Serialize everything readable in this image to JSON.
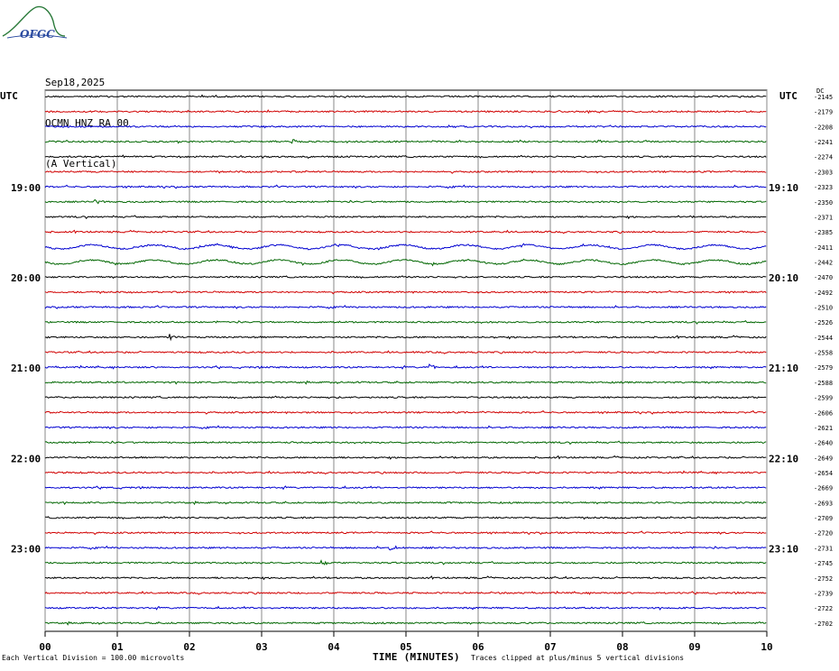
{
  "logo": {
    "text": "OFGC",
    "color": "#2a7a3a"
  },
  "header": {
    "date": "Sep18,2025",
    "station": "OCMN HNZ RA 00",
    "component": "(A Vertical)"
  },
  "utc_label_left": "UTC",
  "utc_label_right": "UTC",
  "dc_label": "DC",
  "footnote_left": "Each Vertical Division =  100.00 microvolts",
  "footnote_right": "Traces clipped at plus/minus 5 vertical divisions",
  "chart_data": {
    "type": "line",
    "xlabel": "TIME (MINUTES)",
    "xlim": [
      0,
      10
    ],
    "x_ticks": [
      "00",
      "01",
      "02",
      "03",
      "04",
      "05",
      "06",
      "07",
      "08",
      "09",
      "10"
    ],
    "trace_colors": [
      "#000000",
      "#d00000",
      "#0000d0",
      "#006600"
    ],
    "left_time_labels": [
      {
        "trace": 6,
        "label": "19:00"
      },
      {
        "trace": 12,
        "label": "20:00"
      },
      {
        "trace": 18,
        "label": "21:00"
      },
      {
        "trace": 24,
        "label": "22:00"
      },
      {
        "trace": 30,
        "label": "23:00"
      }
    ],
    "right_time_labels": [
      {
        "trace": 6,
        "label": "19:10"
      },
      {
        "trace": 12,
        "label": "20:10"
      },
      {
        "trace": 18,
        "label": "21:10"
      },
      {
        "trace": 24,
        "label": "22:10"
      },
      {
        "trace": 30,
        "label": "23:10"
      }
    ],
    "dc_offsets": [
      "-2145",
      "-2179",
      "-2208",
      "-2241",
      "-2274",
      "-2303",
      "-2323",
      "-2350",
      "-2371",
      "-2385",
      "-2411",
      "-2442",
      "-2470",
      "-2492",
      "-2510",
      "-2526",
      "-2544",
      "-2558",
      "-2579",
      "-2588",
      "-2599",
      "-2606",
      "-2621",
      "-2640",
      "-2649",
      "-2654",
      "-2669",
      "-2693",
      "-2709",
      "-2720",
      "-2731",
      "-2745",
      "-2752",
      "-2739",
      "-2722",
      "-2702"
    ],
    "events": [
      {
        "trace": 3,
        "minute": 3.45
      },
      {
        "trace": 7,
        "minute": 0.7
      },
      {
        "trace": 16,
        "minute": 1.75
      },
      {
        "trace": 18,
        "minute": 5.35
      },
      {
        "trace": 30,
        "minute": 4.8
      },
      {
        "trace": 31,
        "minute": 3.85
      }
    ]
  }
}
